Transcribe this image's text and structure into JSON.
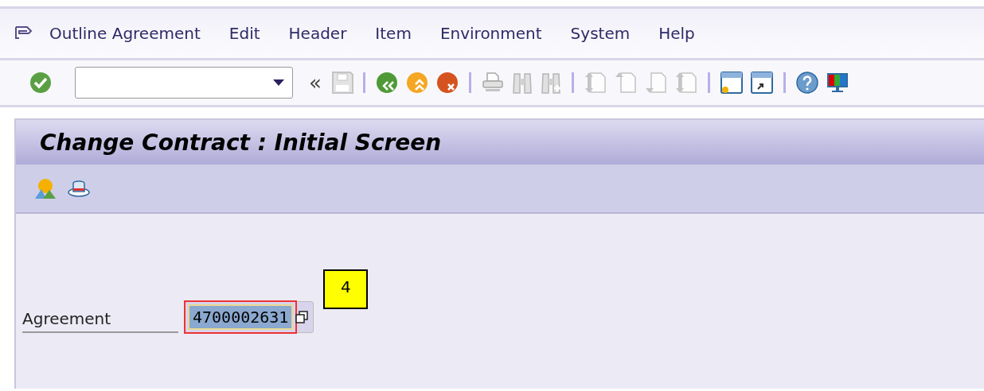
{
  "menu_bar": {
    "items": [
      {
        "label": "Outline Agreement"
      },
      {
        "label": "Edit"
      },
      {
        "label": "Header"
      },
      {
        "label": "Item"
      },
      {
        "label": "Environment"
      },
      {
        "label": "System"
      },
      {
        "label": "Help"
      }
    ]
  },
  "toolbar": {
    "items": [
      {
        "kind": "back-double",
        "label": "«",
        "disabled": false
      },
      {
        "kind": "save",
        "disabled": true
      },
      {
        "kind": "separator"
      },
      {
        "kind": "back",
        "disabled": false
      },
      {
        "kind": "exit",
        "disabled": false
      },
      {
        "kind": "cancel",
        "disabled": false
      },
      {
        "kind": "separator"
      },
      {
        "kind": "print",
        "disabled": true
      },
      {
        "kind": "find",
        "disabled": true
      },
      {
        "kind": "find-next",
        "disabled": true
      },
      {
        "kind": "separator"
      },
      {
        "kind": "first-page",
        "disabled": true
      },
      {
        "kind": "prev-page",
        "disabled": true
      },
      {
        "kind": "next-page",
        "disabled": true
      },
      {
        "kind": "last-page",
        "disabled": true
      },
      {
        "kind": "separator"
      },
      {
        "kind": "new-session",
        "disabled": false
      },
      {
        "kind": "shortcut",
        "disabled": false
      },
      {
        "kind": "separator"
      },
      {
        "kind": "help",
        "disabled": false
      },
      {
        "kind": "layout",
        "disabled": false
      }
    ]
  },
  "screen": {
    "title": "Change Contract : Initial Screen",
    "app_toolbar": [
      {
        "kind": "mountains"
      },
      {
        "kind": "hat"
      }
    ],
    "fields": [
      {
        "label": "Agreement",
        "value": "4700002631",
        "selected": true
      }
    ]
  },
  "callout": {
    "text": "4"
  }
}
